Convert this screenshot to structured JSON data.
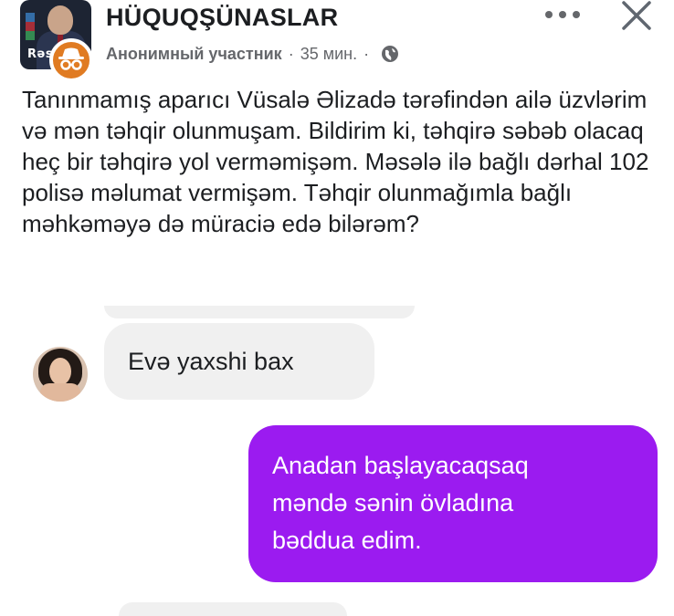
{
  "header": {
    "group_name": "HÜQUQŞÜNASLAR",
    "author": "Анонимный участник",
    "time": "35 мин.",
    "separator": "·",
    "avatar_caption": "Rəs",
    "icons": [
      "more-icon",
      "close-icon",
      "globe-icon",
      "anonymous-icon"
    ]
  },
  "post": {
    "text": "Tanınmamış aparıcı Vüsalə Əlizadə tərəfindən ailə üzvlərim və mən təhqir olunmuşam. Bildirim ki, təhqirə səbəb olacaq heç bir təhqirə yol verməmişəm. Məsələ ilə bağlı dərhal 102 polisə məlumat vermişəm. Təhqir olunmağımla bağlı məhkəməyə də müraciə edə bilərəm?"
  },
  "chat": {
    "received_message": "Evə yaxshi bax",
    "sent_message": "Anadan başlayacaqsaq\nməndə sənin övladına\nbəddua edim."
  },
  "colors": {
    "sent_bubble": "#9b1bf0",
    "received_bubble": "#f0f0f0",
    "anon_badge": "#e07b22",
    "text": "#1c1e21",
    "meta_text": "#65676b"
  }
}
